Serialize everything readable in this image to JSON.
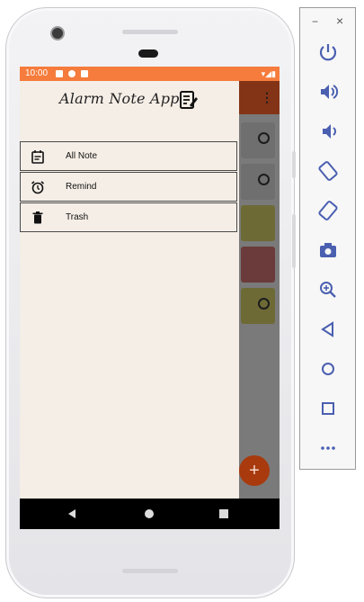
{
  "status_bar": {
    "time": "10:00"
  },
  "drawer": {
    "title": "Alarm Note App",
    "items": [
      {
        "label": "All Note",
        "icon": "calendar-note-icon"
      },
      {
        "label": "Remind",
        "icon": "alarm-clock-icon"
      },
      {
        "label": "Trash",
        "icon": "trash-icon"
      }
    ]
  },
  "background_app": {
    "menu": "⋮",
    "fab_label": "+",
    "cards": [
      {
        "color": "#6f6f6f",
        "icon": "timer-icon"
      },
      {
        "color": "#6f6f6f",
        "icon": "timer-icon"
      },
      {
        "color": "#6e6a36",
        "icon": ""
      },
      {
        "color": "#6b3b3b",
        "icon": ""
      },
      {
        "color": "#6e6a36",
        "icon": "timer-icon"
      }
    ]
  },
  "emulator_panel": {
    "minimize": "−",
    "close": "×",
    "tools": [
      "power-icon",
      "volume-up-icon",
      "volume-down-icon",
      "rotate-left-icon",
      "rotate-right-icon",
      "camera-icon",
      "zoom-icon",
      "back-icon",
      "home-icon",
      "overview-icon",
      "more-icon"
    ]
  },
  "colors": {
    "status_bar": "#f57c3c",
    "drawer_bg": "#f5eee6",
    "appbar": "#833417",
    "fab": "#a83a0e"
  }
}
